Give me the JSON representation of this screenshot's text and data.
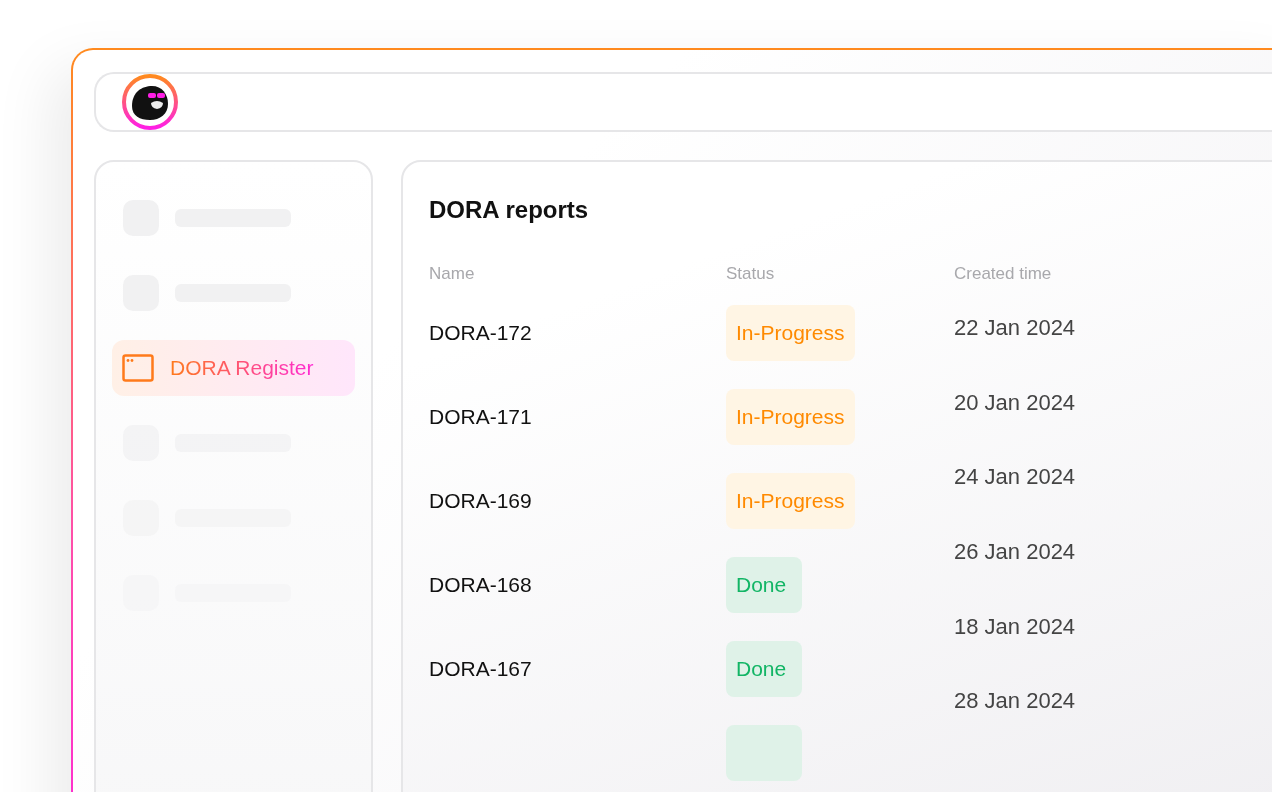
{
  "sidebar": {
    "items": [
      {
        "kind": "placeholder",
        "selected": false
      },
      {
        "kind": "placeholder",
        "selected": false
      },
      {
        "kind": "link",
        "label": "DORA Register",
        "selected": true
      },
      {
        "kind": "placeholder",
        "selected": false
      },
      {
        "kind": "placeholder",
        "selected": false
      },
      {
        "kind": "placeholder",
        "selected": false
      }
    ]
  },
  "reports": {
    "title": "DORA reports",
    "columns": [
      "Name",
      "Status",
      "Created time"
    ],
    "rows": [
      {
        "name": "DORA-172",
        "status": {
          "kind": "in_progress",
          "label": "In-Progress"
        }
      },
      {
        "name": "DORA-171",
        "status": {
          "kind": "in_progress",
          "label": "In-Progress"
        }
      },
      {
        "name": "DORA-169",
        "status": {
          "kind": "in_progress",
          "label": "In-Progress"
        }
      },
      {
        "name": "DORA-168",
        "status": {
          "kind": "done",
          "label": "Done"
        }
      },
      {
        "name": "DORA-167",
        "status": {
          "kind": "done",
          "label": "Done"
        }
      },
      {
        "status": {
          "kind": "done"
        }
      }
    ],
    "created_times": [
      "22 Jan 2024",
      "20 Jan 2024",
      "24 Jan 2024",
      "26 Jan 2024",
      "18 Jan 2024",
      "28 Jan 2024"
    ]
  }
}
